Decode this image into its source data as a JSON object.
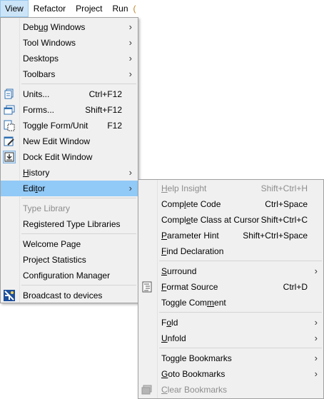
{
  "menubar": {
    "items": [
      "View",
      "Refactor",
      "Project",
      "Run"
    ],
    "cut": "("
  },
  "view_menu": {
    "items": [
      {
        "label": "Debug Windows",
        "shortcut": "",
        "submenu": true
      },
      {
        "label": "Tool Windows",
        "shortcut": "",
        "submenu": true
      },
      {
        "label": "Desktops",
        "shortcut": "",
        "submenu": true
      },
      {
        "label": "Toolbars",
        "shortcut": "",
        "submenu": true
      },
      {
        "label": "Units...",
        "shortcut": "Ctrl+F12",
        "icon": "units-icon"
      },
      {
        "label": "Forms...",
        "shortcut": "Shift+F12",
        "icon": "forms-icon"
      },
      {
        "label": "Toggle Form/Unit",
        "shortcut": "F12",
        "icon": "toggle-form-unit-icon"
      },
      {
        "label": "New Edit Window",
        "shortcut": "",
        "icon": "new-edit-window-icon"
      },
      {
        "label": "Dock Edit Window",
        "shortcut": "",
        "icon": "dock-edit-window-icon"
      },
      {
        "label": "History",
        "shortcut": "",
        "submenu": true
      },
      {
        "label": "Editor",
        "shortcut": "",
        "submenu": true
      },
      {
        "label": "Type Library",
        "shortcut": "",
        "disabled": true
      },
      {
        "label": "Registered Type Libraries",
        "shortcut": ""
      },
      {
        "label": "Welcome Page",
        "shortcut": ""
      },
      {
        "label": "Project Statistics",
        "shortcut": ""
      },
      {
        "label": "Configuration Manager",
        "shortcut": ""
      },
      {
        "label": "Broadcast to devices",
        "shortcut": "",
        "icon": "broadcast-icon"
      }
    ]
  },
  "editor_menu": {
    "items": [
      {
        "label": "Help Insight",
        "shortcut": "Shift+Ctrl+H",
        "disabled": true
      },
      {
        "label": "Complete Code",
        "shortcut": "Ctrl+Space"
      },
      {
        "label": "Complete Class at Cursor",
        "shortcut": "Shift+Ctrl+C"
      },
      {
        "label": "Parameter Hint",
        "shortcut": "Shift+Ctrl+Space"
      },
      {
        "label": "Find Declaration",
        "shortcut": ""
      },
      {
        "label": "Surround",
        "shortcut": "",
        "submenu": true
      },
      {
        "label": "Format Source",
        "shortcut": "Ctrl+D",
        "icon": "format-source-icon"
      },
      {
        "label": "Toggle Comment",
        "shortcut": ""
      },
      {
        "label": "Fold",
        "shortcut": "",
        "submenu": true
      },
      {
        "label": "Unfold",
        "shortcut": "",
        "submenu": true
      },
      {
        "label": "Toggle Bookmarks",
        "shortcut": "",
        "submenu": true
      },
      {
        "label": "Goto Bookmarks",
        "shortcut": "",
        "submenu": true
      },
      {
        "label": "Clear Bookmarks",
        "shortcut": "",
        "disabled": true,
        "icon": "clear-bookmarks-icon"
      }
    ]
  },
  "colors": {
    "menu_bg": "#f0f0f0",
    "highlight": "#91c9f7",
    "menubar_active": "#cce4f7",
    "disabled_text": "#8d8d8d"
  }
}
